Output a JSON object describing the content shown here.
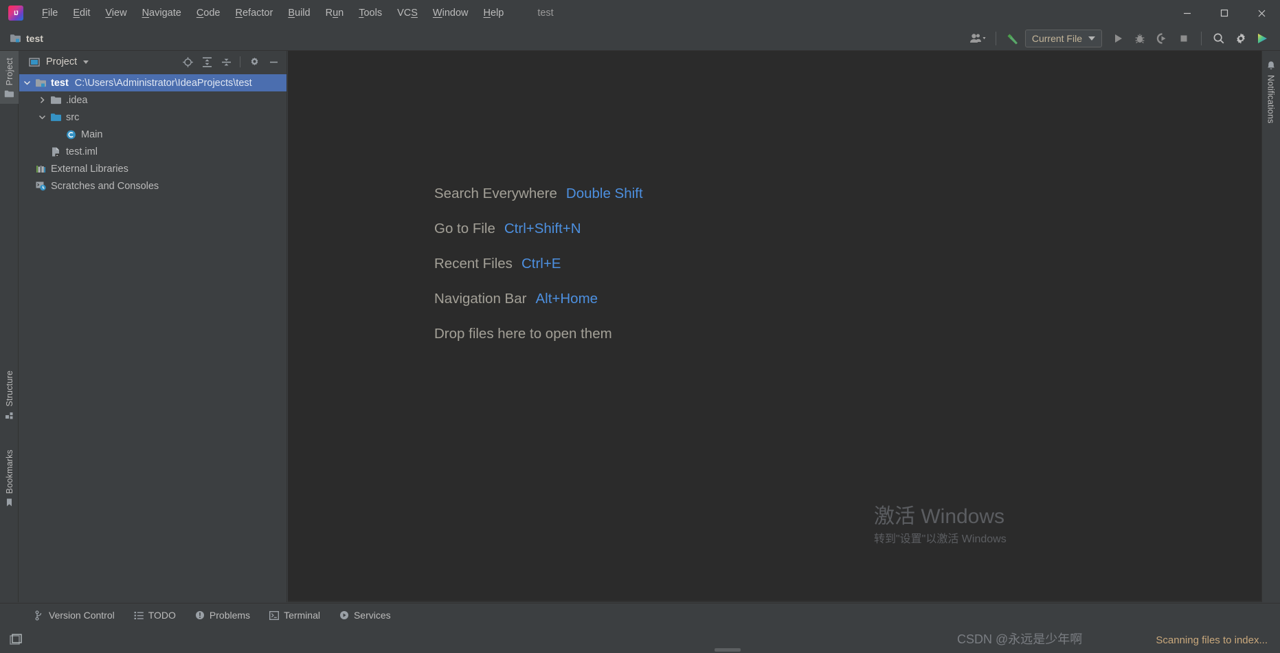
{
  "window": {
    "title": "test",
    "controls": {
      "minimize": "minimize-icon",
      "maximize": "maximize-icon",
      "close": "close-icon"
    }
  },
  "menubar": {
    "items": [
      {
        "label": "File",
        "mnemonic": "F"
      },
      {
        "label": "Edit",
        "mnemonic": "E"
      },
      {
        "label": "View",
        "mnemonic": "V"
      },
      {
        "label": "Navigate",
        "mnemonic": "N"
      },
      {
        "label": "Code",
        "mnemonic": "C"
      },
      {
        "label": "Refactor",
        "mnemonic": "R"
      },
      {
        "label": "Build",
        "mnemonic": "B"
      },
      {
        "label": "Run",
        "mnemonic": "u"
      },
      {
        "label": "Tools",
        "mnemonic": "T"
      },
      {
        "label": "VCS",
        "mnemonic": "S"
      },
      {
        "label": "Window",
        "mnemonic": "W"
      },
      {
        "label": "Help",
        "mnemonic": "H"
      }
    ]
  },
  "navbar": {
    "module": "test",
    "module_icon": "module-folder-icon"
  },
  "toolbar": {
    "account_icon": "account-icon",
    "build_icon": "build-hammer-icon",
    "run_config": {
      "label": "Current File",
      "caret": "chevron-down-icon"
    },
    "run_icon": "run-icon",
    "debug_icon": "debug-bug-icon",
    "coverage_icon": "run-with-coverage-icon",
    "stop_icon": "stop-icon",
    "search_icon": "search-icon",
    "settings_icon": "gear-icon",
    "updates_icon": "ide-updates-icon"
  },
  "left_stripe": {
    "tabs": [
      {
        "label": "Project",
        "icon": "project-folder-icon",
        "selected": true
      },
      {
        "label": "Structure",
        "icon": "structure-icon",
        "selected": false
      },
      {
        "label": "Bookmarks",
        "icon": "bookmark-icon",
        "selected": false
      }
    ]
  },
  "right_stripe": {
    "tabs": [
      {
        "label": "Notifications",
        "icon": "bell-icon",
        "selected": false
      }
    ]
  },
  "project_panel": {
    "title": "Project",
    "title_icon": "project-view-icon",
    "caret": "chevron-down-icon",
    "tools": [
      {
        "name": "select-opened-file-button",
        "icon": "locate-crosshair-icon"
      },
      {
        "name": "expand-all-button",
        "icon": "expand-all-icon"
      },
      {
        "name": "collapse-all-button",
        "icon": "collapse-all-icon"
      },
      {
        "name": "options-button",
        "icon": "gear-icon"
      },
      {
        "name": "hide-button",
        "icon": "minimize-icon"
      }
    ],
    "tree": [
      {
        "label": "test",
        "path": "C:\\Users\\Administrator\\IdeaProjects\\test",
        "icon": "module-folder-icon",
        "twisty": "expanded",
        "indent": 0,
        "selected": true,
        "bold": true
      },
      {
        "label": ".idea",
        "path": "",
        "icon": "folder-icon",
        "twisty": "collapsed",
        "indent": 1,
        "selected": false,
        "bold": false
      },
      {
        "label": "src",
        "path": "",
        "icon": "source-root-folder-icon",
        "twisty": "expanded",
        "indent": 1,
        "selected": false,
        "bold": false
      },
      {
        "label": "Main",
        "path": "",
        "icon": "java-class-icon",
        "twisty": "none",
        "indent": 2,
        "selected": false,
        "bold": false
      },
      {
        "label": "test.iml",
        "path": "",
        "icon": "iml-file-icon",
        "twisty": "none",
        "indent": 1,
        "selected": false,
        "bold": false
      },
      {
        "label": "External Libraries",
        "path": "",
        "icon": "external-libraries-icon",
        "twisty": "none",
        "indent": 0,
        "selected": false,
        "bold": false
      },
      {
        "label": "Scratches and Consoles",
        "path": "",
        "icon": "scratches-consoles-icon",
        "twisty": "none",
        "indent": 0,
        "selected": false,
        "bold": false
      }
    ]
  },
  "editor": {
    "welcome_rows": [
      {
        "label": "Search Everywhere",
        "shortcut": "Double Shift"
      },
      {
        "label": "Go to File",
        "shortcut": "Ctrl+Shift+N"
      },
      {
        "label": "Recent Files",
        "shortcut": "Ctrl+E"
      },
      {
        "label": "Navigation Bar",
        "shortcut": "Alt+Home"
      },
      {
        "label": "Drop files here to open them",
        "shortcut": ""
      }
    ]
  },
  "bottom_stripe": {
    "tabs": [
      {
        "label": "Version Control",
        "icon": "version-control-branch-icon"
      },
      {
        "label": "TODO",
        "icon": "todo-list-icon"
      },
      {
        "label": "Problems",
        "icon": "problems-icon"
      },
      {
        "label": "Terminal",
        "icon": "terminal-icon"
      },
      {
        "label": "Services",
        "icon": "services-icon"
      }
    ]
  },
  "statusbar": {
    "layout_icon": "tool-window-layout-icon",
    "message": "Scanning files to index..."
  },
  "watermarks": {
    "windows_activate_line1": "激活 Windows",
    "windows_activate_line2": "转到\"设置\"以激活 Windows",
    "csdn": "CSDN @永远是少年啊"
  },
  "colors": {
    "chrome": "#3c3f41",
    "editor_bg": "#2b2b2b",
    "selection_blue": "#4b6eaf",
    "shortcut_blue": "#4d90e0",
    "text_gray": "#bbbbbb",
    "status_orange": "#c9a87c",
    "source_root": "#3592c4"
  }
}
